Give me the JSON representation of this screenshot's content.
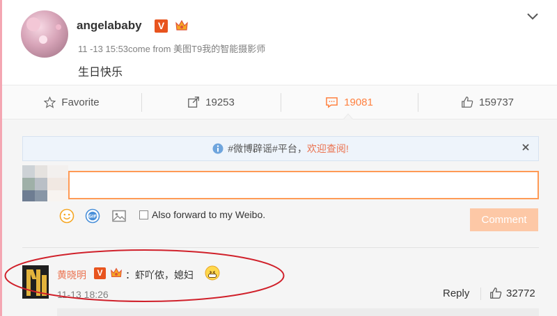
{
  "post": {
    "username": "angelababy",
    "v_badge": "V",
    "meta": "11 -13 15:53come from 美图T9我的智能摄影师",
    "text": "生日快乐"
  },
  "actions": {
    "favorite": "Favorite",
    "forward_count": "19253",
    "comment_count": "19081",
    "like_count": "159737"
  },
  "notice": {
    "prefix": "#微博辟谣#平台，",
    "link": "欢迎查阅!"
  },
  "composer": {
    "input_value": "",
    "forward_label": "Also forward to my Weibo.",
    "comment_button": "Comment"
  },
  "comment": {
    "username": "黄晓明",
    "v_badge": "V",
    "text": "：虾吖侬，媳妇",
    "time": "11-13 18:26",
    "reply_label": "Reply",
    "like_count": "32772"
  },
  "colors": {
    "accent": "#ff8140",
    "link": "#eb7350",
    "v_badge": "#e8541e",
    "comment_button": "#fdc8a6",
    "annotation": "#d0202a"
  },
  "icons": [
    "chevron-down-icon",
    "star-icon",
    "share-icon",
    "comment-icon",
    "thumbs-up-icon",
    "info-icon",
    "close-icon",
    "emoji-icon",
    "gif-icon",
    "image-icon",
    "crown-icon"
  ]
}
